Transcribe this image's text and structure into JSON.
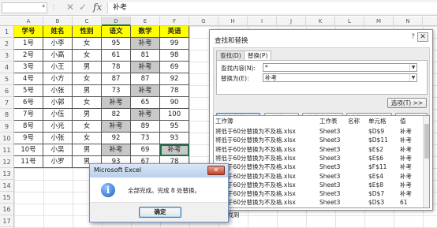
{
  "formula_bar": {
    "name_box": "",
    "dropdown": "▾",
    "separator": "⋮",
    "cancel": "✕",
    "enter": "✓",
    "fx": "fx",
    "content": "补考"
  },
  "columns": [
    "A",
    "B",
    "C",
    "D",
    "E",
    "F",
    "G",
    "H",
    "I",
    "J",
    "K",
    "L",
    "M",
    "N"
  ],
  "rows": [
    "1",
    "2",
    "3",
    "4",
    "5",
    "6",
    "7",
    "8",
    "9",
    "10",
    "11",
    "12",
    "13",
    "14",
    "15",
    "16",
    "17"
  ],
  "table": {
    "headers": [
      "学号",
      "姓名",
      "性别",
      "语文",
      "数学",
      "英语"
    ],
    "rows": [
      [
        "1号",
        "小李",
        "女",
        "95",
        "补考",
        "99"
      ],
      [
        "2号",
        "小高",
        "女",
        "61",
        "81",
        "98"
      ],
      [
        "3号",
        "小王",
        "男",
        "78",
        "补考",
        "69"
      ],
      [
        "4号",
        "小方",
        "女",
        "87",
        "87",
        "92"
      ],
      [
        "5号",
        "小张",
        "男",
        "73",
        "补考",
        "78"
      ],
      [
        "6号",
        "小郭",
        "女",
        "补考",
        "65",
        "90"
      ],
      [
        "7号",
        "小伍",
        "男",
        "82",
        "补考",
        "100"
      ],
      [
        "8号",
        "小光",
        "女",
        "补考",
        "89",
        "95"
      ],
      [
        "9号",
        "小张",
        "女",
        "92",
        "73",
        "93"
      ],
      [
        "10号",
        "小吴",
        "男",
        "补考",
        "69",
        "补考"
      ],
      [
        "11号",
        "小罗",
        "男",
        "93",
        "67",
        "78"
      ]
    ]
  },
  "find_replace": {
    "title": "查找和替换",
    "help": "?",
    "close": "✕",
    "tabs": [
      "查找(D)",
      "替换(P)"
    ],
    "find_label": "查找内容(N):",
    "find_value": "*",
    "replace_label": "替换为(E):",
    "replace_value": "补考",
    "options_button": "选项(T) >>",
    "buttons": {
      "replace_all": "全部替换(A)",
      "replace": "替换(R)",
      "find_all": "查找全部(I)",
      "find_next": "查找下一个(F)",
      "close": "关闭"
    },
    "result_columns": [
      "工作簿",
      "工作表",
      "名称",
      "单元格",
      "值"
    ],
    "results": [
      [
        "将低于60分替换为不及格.xlsx",
        "Sheet3",
        "",
        "$D$9",
        "补考"
      ],
      [
        "将低于60分替换为不及格.xlsx",
        "Sheet3",
        "",
        "$D$11",
        "补考"
      ],
      [
        "将低于60分替换为不及格.xlsx",
        "Sheet3",
        "",
        "$E$2",
        "补考"
      ],
      [
        "将低于60分替换为不及格.xlsx",
        "Sheet3",
        "",
        "$E$6",
        "补考"
      ],
      [
        "将低于60分替换为不及格.xlsx",
        "Sheet3",
        "",
        "$F$11",
        "补考"
      ],
      [
        "将低于60分替换为不及格.xlsx",
        "Sheet3",
        "",
        "$E$4",
        "补考"
      ],
      [
        "将低于60分替换为不及格.xlsx",
        "Sheet3",
        "",
        "$E$8",
        "补考"
      ],
      [
        "将低于60分替换为不及格.xlsx",
        "Sheet3",
        "",
        "$D$7",
        "补考"
      ],
      [
        "将低于60分替换为不及格.xlsx",
        "Sheet3",
        "",
        "$D$3",
        "61"
      ]
    ],
    "status": "元格被找到"
  },
  "message_box": {
    "title": "Microsoft Excel",
    "close": "✕",
    "icon": "info-icon",
    "icon_glyph": "i",
    "text": "全部完成。完成 8 处替换。",
    "ok": "确定"
  }
}
